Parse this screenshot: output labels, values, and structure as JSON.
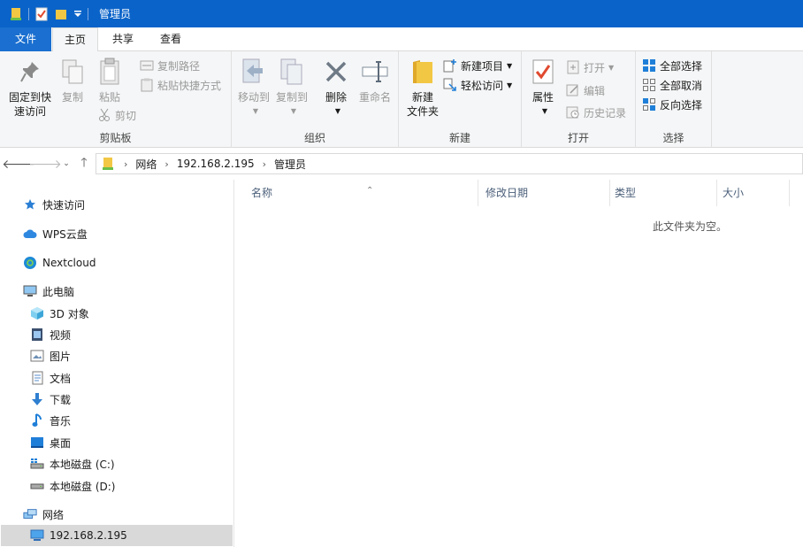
{
  "window": {
    "title": "管理员"
  },
  "ribbon_tabs": {
    "file": "文件",
    "home": "主页",
    "share": "共享",
    "view": "查看"
  },
  "clipboard": {
    "pin_line1": "固定到快",
    "pin_line2": "速访问",
    "copy": "复制",
    "paste": "粘贴",
    "copy_path": "复制路径",
    "paste_shortcut": "粘贴快捷方式",
    "cut": "剪切",
    "label": "剪贴板"
  },
  "organize": {
    "move_to": "移动到",
    "copy_to": "复制到",
    "delete": "删除",
    "rename": "重命名",
    "label": "组织"
  },
  "new_group": {
    "new_folder_line1": "新建",
    "new_folder_line2": "文件夹",
    "new_item": "新建项目",
    "easy_access": "轻松访问",
    "label": "新建"
  },
  "open_group": {
    "properties": "属性",
    "open": "打开",
    "edit": "编辑",
    "history": "历史记录",
    "label": "打开"
  },
  "select_group": {
    "select_all": "全部选择",
    "select_none": "全部取消",
    "invert": "反向选择",
    "label": "选择"
  },
  "address": {
    "crumbs": [
      "网络",
      "192.168.2.195",
      "管理员"
    ]
  },
  "nav": {
    "quick_access": "快速访问",
    "wps": "WPS云盘",
    "nextcloud": "Nextcloud",
    "this_pc": "此电脑",
    "objects3d": "3D 对象",
    "videos": "视频",
    "pictures": "图片",
    "documents": "文档",
    "downloads": "下载",
    "music": "音乐",
    "desktop": "桌面",
    "drive_c": "本地磁盘 (C:)",
    "drive_d": "本地磁盘 (D:)",
    "network": "网络",
    "host": "192.168.2.195"
  },
  "columns": {
    "name": "名称",
    "modified": "修改日期",
    "type": "类型",
    "size": "大小"
  },
  "content": {
    "empty_text": "此文件夹为空。"
  },
  "colors": {
    "titlebar": "#0a63c9",
    "file_tab": "#1a6fd0",
    "folder": "#f2c744",
    "accent_blue": "#1f7fd8"
  }
}
